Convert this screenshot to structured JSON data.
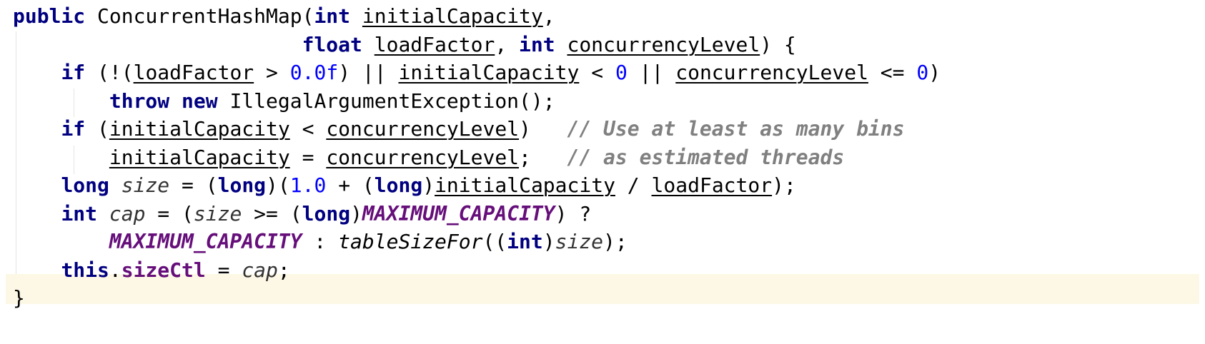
{
  "code_lines": [
    [
      {
        "text": "public",
        "type": "kw"
      },
      {
        "text": " ConcurrentHashMap(",
        "type": "plain"
      },
      {
        "text": "int",
        "type": "kw"
      },
      {
        "text": " ",
        "type": "plain"
      },
      {
        "text": "initialCapacity",
        "type": "param"
      },
      {
        "text": ",",
        "type": "plain"
      }
    ],
    [
      {
        "text": "                        ",
        "type": "plain"
      },
      {
        "text": "float",
        "type": "kw"
      },
      {
        "text": " ",
        "type": "plain"
      },
      {
        "text": "loadFactor",
        "type": "param"
      },
      {
        "text": ", ",
        "type": "plain"
      },
      {
        "text": "int",
        "type": "kw"
      },
      {
        "text": " ",
        "type": "plain"
      },
      {
        "text": "concurrencyLevel",
        "type": "param"
      },
      {
        "text": ") {",
        "type": "plain"
      }
    ],
    [
      {
        "text": "    ",
        "type": "plain"
      },
      {
        "text": "if",
        "type": "kw"
      },
      {
        "text": " (!(",
        "type": "plain"
      },
      {
        "text": "loadFactor",
        "type": "param"
      },
      {
        "text": " > ",
        "type": "plain"
      },
      {
        "text": "0.0f",
        "type": "num"
      },
      {
        "text": ") || ",
        "type": "plain"
      },
      {
        "text": "initialCapacity",
        "type": "param"
      },
      {
        "text": " < ",
        "type": "plain"
      },
      {
        "text": "0",
        "type": "num"
      },
      {
        "text": " || ",
        "type": "plain"
      },
      {
        "text": "concurrencyLevel",
        "type": "param"
      },
      {
        "text": " <= ",
        "type": "plain"
      },
      {
        "text": "0",
        "type": "num"
      },
      {
        "text": ")",
        "type": "plain"
      }
    ],
    [
      {
        "text": "        ",
        "type": "plain"
      },
      {
        "text": "throw",
        "type": "kw"
      },
      {
        "text": " ",
        "type": "plain"
      },
      {
        "text": "new",
        "type": "kw"
      },
      {
        "text": " IllegalArgumentException();",
        "type": "plain"
      }
    ],
    [
      {
        "text": "    ",
        "type": "plain"
      },
      {
        "text": "if",
        "type": "kw"
      },
      {
        "text": " (",
        "type": "plain"
      },
      {
        "text": "initialCapacity",
        "type": "param"
      },
      {
        "text": " < ",
        "type": "plain"
      },
      {
        "text": "concurrencyLevel",
        "type": "param"
      },
      {
        "text": ")   ",
        "type": "plain"
      },
      {
        "text": "// Use at least as many bins",
        "type": "cmt"
      }
    ],
    [
      {
        "text": "        ",
        "type": "plain"
      },
      {
        "text": "initialCapacity",
        "type": "param"
      },
      {
        "text": " = ",
        "type": "plain"
      },
      {
        "text": "concurrencyLevel",
        "type": "param"
      },
      {
        "text": ";   ",
        "type": "plain"
      },
      {
        "text": "// as estimated threads",
        "type": "cmt"
      }
    ],
    [
      {
        "text": "    ",
        "type": "plain"
      },
      {
        "text": "long",
        "type": "kw"
      },
      {
        "text": " ",
        "type": "plain"
      },
      {
        "text": "size",
        "type": "local"
      },
      {
        "text": " = (",
        "type": "plain"
      },
      {
        "text": "long",
        "type": "kw"
      },
      {
        "text": ")(",
        "type": "plain"
      },
      {
        "text": "1.0",
        "type": "num"
      },
      {
        "text": " + (",
        "type": "plain"
      },
      {
        "text": "long",
        "type": "kw"
      },
      {
        "text": ")",
        "type": "plain"
      },
      {
        "text": "initialCapacity",
        "type": "param"
      },
      {
        "text": " / ",
        "type": "plain"
      },
      {
        "text": "loadFactor",
        "type": "param"
      },
      {
        "text": ");",
        "type": "plain"
      }
    ],
    [
      {
        "text": "    ",
        "type": "plain"
      },
      {
        "text": "int",
        "type": "kw"
      },
      {
        "text": " ",
        "type": "plain"
      },
      {
        "text": "cap",
        "type": "local"
      },
      {
        "text": " = (",
        "type": "plain"
      },
      {
        "text": "size",
        "type": "local"
      },
      {
        "text": " >= (",
        "type": "plain"
      },
      {
        "text": "long",
        "type": "kw"
      },
      {
        "text": ")",
        "type": "plain"
      },
      {
        "text": "MAXIMUM_CAPACITY",
        "type": "const"
      },
      {
        "text": ") ?",
        "type": "plain"
      }
    ],
    [
      {
        "text": "        ",
        "type": "plain"
      },
      {
        "text": "MAXIMUM_CAPACITY",
        "type": "const"
      },
      {
        "text": " : ",
        "type": "plain"
      },
      {
        "text": "tableSizeFor",
        "type": "call"
      },
      {
        "text": "((",
        "type": "plain"
      },
      {
        "text": "int",
        "type": "kw"
      },
      {
        "text": ")",
        "type": "plain"
      },
      {
        "text": "size",
        "type": "local"
      },
      {
        "text": ");",
        "type": "plain"
      }
    ],
    [
      {
        "text": "    ",
        "type": "plain"
      },
      {
        "text": "this",
        "type": "kw"
      },
      {
        "text": ".",
        "type": "plain"
      },
      {
        "text": "sizeCtl",
        "type": "field"
      },
      {
        "text": " = ",
        "type": "plain"
      },
      {
        "text": "cap",
        "type": "local"
      },
      {
        "text": ";",
        "type": "plain"
      }
    ],
    [
      {
        "text": "}",
        "type": "plain"
      }
    ]
  ]
}
